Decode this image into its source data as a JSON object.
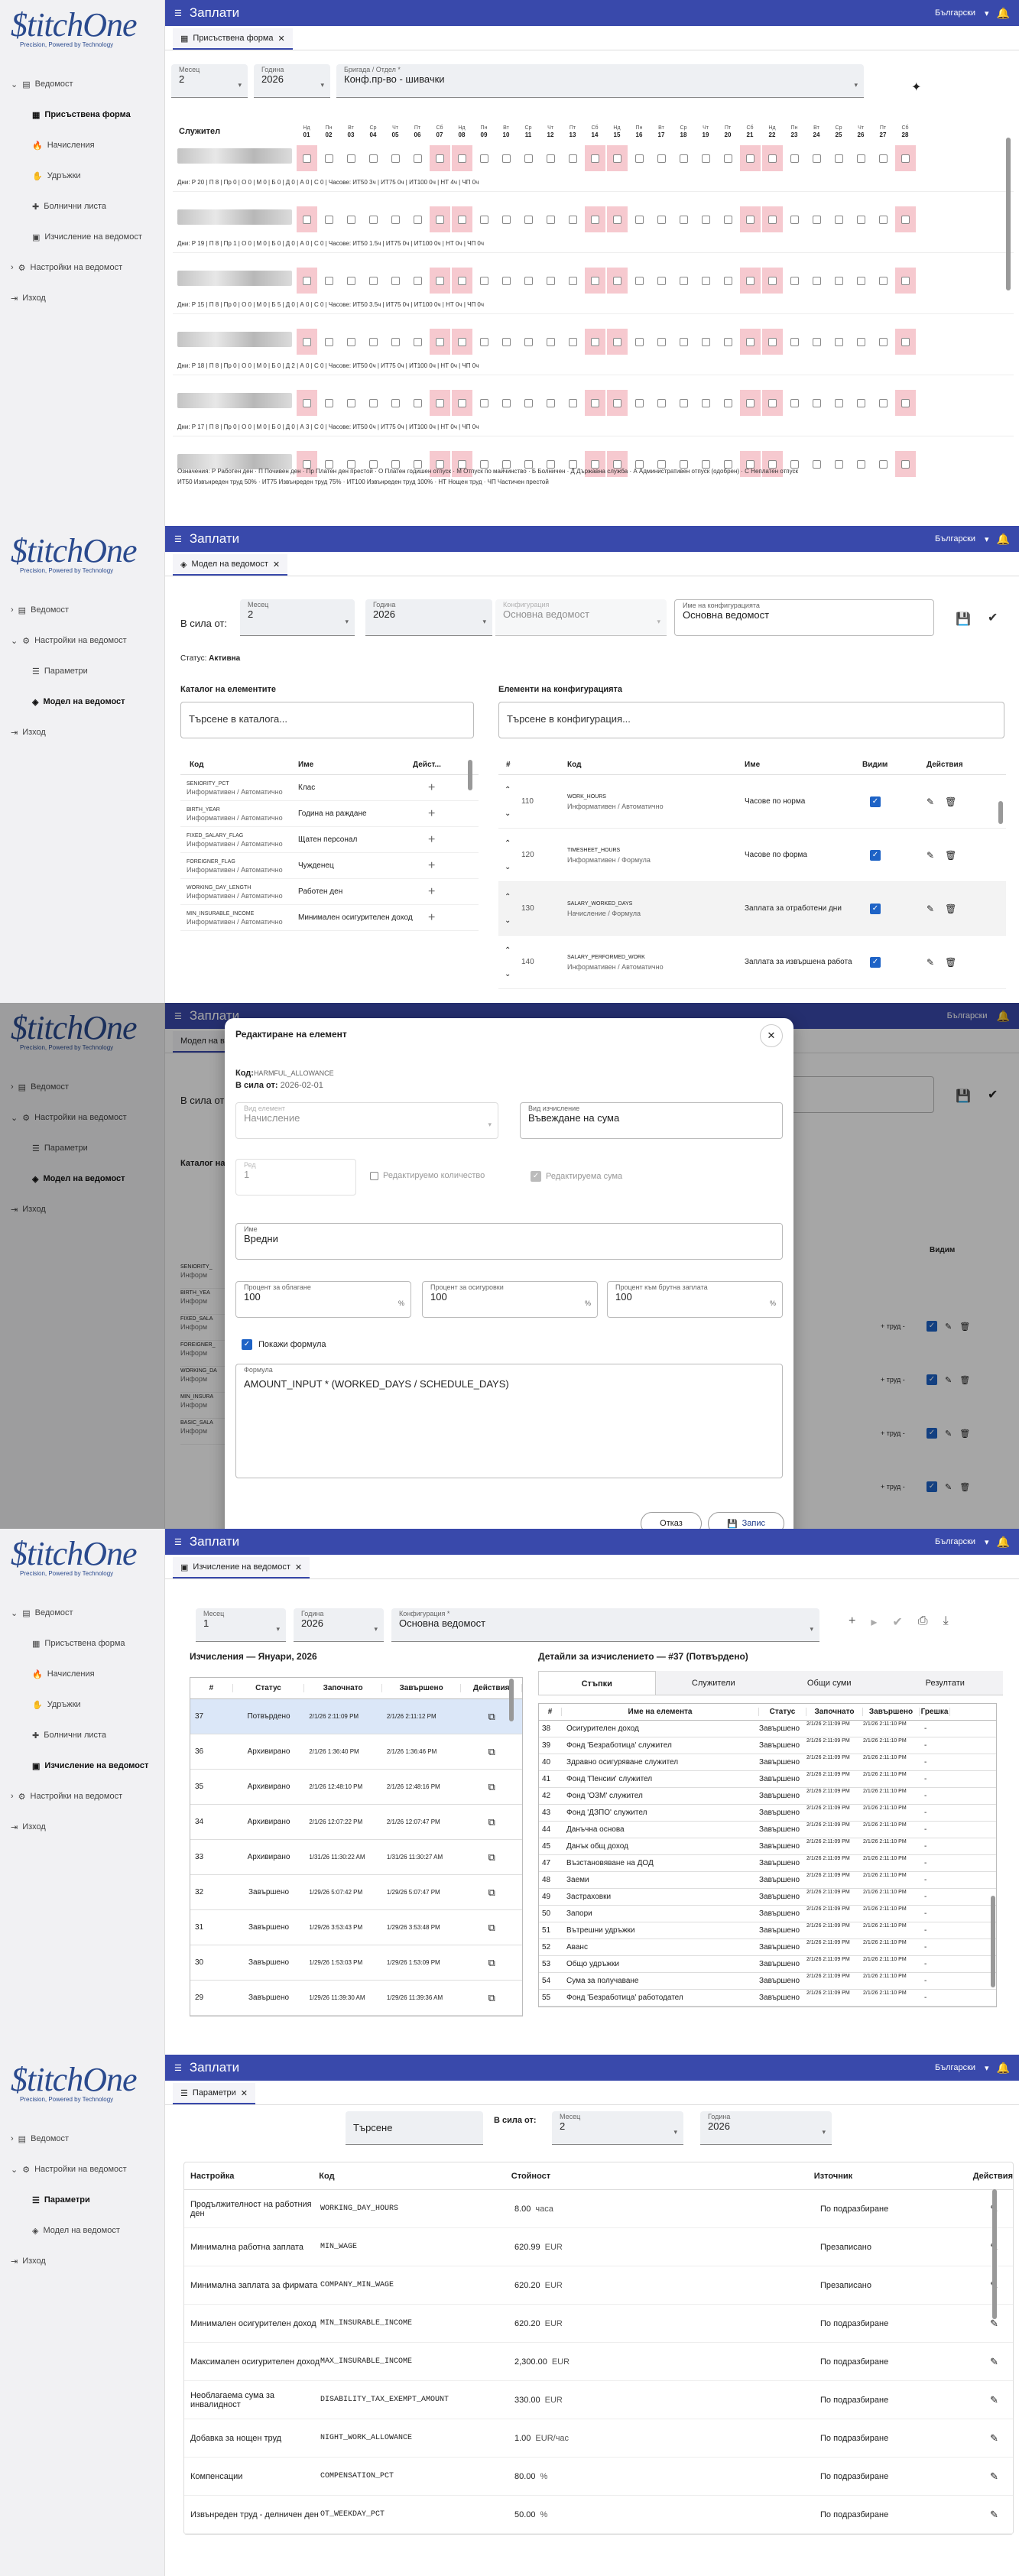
{
  "app": {
    "logo_text": "$titchOne",
    "logo_tagline": "Precision, Powered by Technology",
    "title": "Заплати",
    "language": "Български",
    "nav": {
      "payroll": "Ведомост",
      "attendance": "Присъствена форма",
      "accruals": "Начисления",
      "deductions": "Удръжки",
      "sick": "Болнични листа",
      "calc": "Изчисление на ведомост",
      "settings": "Настройки на ведомост",
      "params": "Параметри",
      "model": "Модел на ведомост",
      "logout": "Изход"
    }
  },
  "s1": {
    "tab": "Присъствена форма",
    "month_label": "Месец",
    "month": "2",
    "year_label": "Година",
    "year": "2026",
    "brigade_label": "Бригада / Отдел *",
    "brigade": "Конф.пр-во - шивачки",
    "employee_col": "Служител",
    "day_names": [
      "Нд",
      "Пн",
      "Вт",
      "Ср",
      "Чт",
      "Пт",
      "Сб",
      "Нд",
      "Пн",
      "Вт",
      "Ср",
      "Чт",
      "Пт",
      "Сб",
      "Нд",
      "Пн",
      "Вт",
      "Ср",
      "Чт",
      "Пт",
      "Сб",
      "Нд",
      "Пн",
      "Вт",
      "Ср",
      "Чт",
      "Пт",
      "Сб"
    ],
    "days": [
      "01",
      "02",
      "03",
      "04",
      "05",
      "06",
      "07",
      "08",
      "09",
      "10",
      "11",
      "12",
      "13",
      "14",
      "15",
      "16",
      "17",
      "18",
      "19",
      "20",
      "21",
      "22",
      "23",
      "24",
      "25",
      "26",
      "27",
      "28"
    ],
    "summaries": [
      "Дни: Р 20 | П 8 | Пр 0 | О 0 | М 0 | Б 0 | Д 0 | А 0 | С 0 | Часове: ИТ50 3ч | ИТ75 0ч | ИТ100 0ч | НТ 4ч | ЧП 0ч",
      "Дни: Р 19 | П 8 | Пр 1 | О 0 | М 0 | Б 0 | Д 0 | А 0 | С 0 | Часове: ИТ50 1.5ч | ИТ75 0ч | ИТ100 0ч | НТ 0ч | ЧП 0ч",
      "Дни: Р 15 | П 8 | Пр 0 | О 0 | М 0 | Б 5 | Д 0 | А 0 | С 0 | Часове: ИТ50 3.5ч | ИТ75 0ч | ИТ100 0ч | НТ 0ч | ЧП 0ч",
      "Дни: Р 18 | П 8 | Пр 0 | О 0 | М 0 | Б 0 | Д 2 | А 0 | С 0 | Часове: ИТ50 0ч | ИТ75 0ч | ИТ100 0ч | НТ 0ч | ЧП 0ч",
      "Дни: Р 17 | П 8 | Пр 0 | О 0 | М 0 | Б 0 | Д 0 | А 3 | С 0 | Часове: ИТ50 0ч | ИТ75 0ч | ИТ100 0ч | НТ 0ч | ЧП 0ч"
    ],
    "legend1": "Означения: Р Работен ден · П Почивен ден · Пр Платен ден престой · О Платен годишен отпуск · М Отпуск по майчинство · Б Болничен · Д Държавна служба · А Административен отпуск (одобрен) · С Неплатен отпуск",
    "legend2": "ИТ50 Извънреден труд 50% · ИТ75 Извънреден труд 75% · ИТ100 Извънреден труд 100% · НТ Нощен труд · ЧП Частичен престой"
  },
  "s2": {
    "tab": "Модел на ведомост",
    "effective_label": "В сила от:",
    "month_label": "Месец",
    "month": "2",
    "year_label": "Година",
    "year": "2026",
    "config_label": "Конфигурация",
    "config": "Основна ведомост",
    "config_name_label": "Име на конфигурацията",
    "config_name": "Основна ведомост",
    "status_label": "Статус:",
    "status": "Активна",
    "catalog_title": "Каталог на елементите",
    "catalog_search": "Търсене в каталога...",
    "catalog_cols": {
      "code": "Код",
      "name": "Име",
      "actions": "Дейст..."
    },
    "catalog": [
      {
        "code": "SENIORITY_PCT",
        "type": "Информативен / Автоматично",
        "name": "Клас"
      },
      {
        "code": "BIRTH_YEAR",
        "type": "Информативен / Автоматично",
        "name": "Година на раждане"
      },
      {
        "code": "FIXED_SALARY_FLAG",
        "type": "Информативен / Автоматично",
        "name": "Щатен персонал"
      },
      {
        "code": "FOREIGNER_FLAG",
        "type": "Информативен / Автоматично",
        "name": "Чужденец"
      },
      {
        "code": "WORKING_DAY_LENGTH",
        "type": "Информативен / Автоматично",
        "name": "Работен ден"
      },
      {
        "code": "MIN_INSURABLE_INCOME",
        "type": "Информативен / Автоматично",
        "name": "Минимален осигурителен доход"
      }
    ],
    "config_title": "Елементи на конфигурацията",
    "config_search": "Търсене в конфигурация...",
    "config_cols": {
      "no": "#",
      "code": "Код",
      "name": "Име",
      "visible": "Видим",
      "actions": "Действия"
    },
    "config_items": [
      {
        "no": "110",
        "code": "WORK_HOURS",
        "type": "Информативен / Автоматично",
        "name": "Часове по норма"
      },
      {
        "no": "120",
        "code": "TIMESHEET_HOURS",
        "type": "Информативен / Формула",
        "name": "Часове по форма"
      },
      {
        "no": "130",
        "code": "SALARY_WORKED_DAYS",
        "type": "Начисление / Формула",
        "name": "Заплата за отработени дни"
      },
      {
        "no": "140",
        "code": "SALARY_PERFORMED_WORK",
        "type": "Информативен / Автоматично",
        "name": "Заплата за извършена работа"
      }
    ]
  },
  "s3": {
    "dialog_title": "Редактиране на елемент",
    "code_label": "Код:",
    "code": "HARMFUL_ALLOWANCE",
    "eff_label": "В сила от:",
    "eff": "2026-02-01",
    "element_type_label": "Вид елемент",
    "element_type": "Начисление",
    "calc_type_label": "Вид изчисление",
    "calc_type": "Въвеждане на сума",
    "order_label": "Ред",
    "order": "1",
    "edit_qty": "Редактируемо количество",
    "edit_sum": "Редактируема сума",
    "name_label": "Име",
    "name": "Вредни",
    "tax_label": "Процент за облагане",
    "tax": "100",
    "ins_label": "Процент за осигуровки",
    "ins": "100",
    "gross_label": "Процент към брутна заплата",
    "gross": "100",
    "pct": "%",
    "show_formula": "Покажи формула",
    "formula_label": "Формула",
    "formula": "AMOUNT_INPUT * (WORKED_DAYS / SCHEDULE_DAYS)",
    "cancel": "Отказ",
    "save": "Запис",
    "bg_codes": [
      "SENIORITY_",
      "BIRTH_YEA",
      "FIXED_SALA",
      "FOREIGNER_",
      "WORKING_DA",
      "MIN_INSURA",
      "BASIC_SALA"
    ],
    "bg_text": "Информ",
    "bg_right": "+ труд -",
    "bg_visible_label": "Видим"
  },
  "s4": {
    "tab": "Изчисление на ведомост",
    "month_label": "Месец",
    "month": "1",
    "year_label": "Година",
    "year": "2026",
    "config_label": "Конфигурация *",
    "config": "Основна ведомост",
    "list_title": "Изчисления — Януари, 2026",
    "list_cols": [
      "#",
      "Статус",
      "Започнато",
      "Завършено",
      "Действия"
    ],
    "runs": [
      {
        "no": "37",
        "status": "Потвърдено",
        "start": "2/1/26 2:11:09 PM",
        "end": "2/1/26 2:11:12 PM"
      },
      {
        "no": "36",
        "status": "Архивирано",
        "start": "2/1/26 1:36:40 PM",
        "end": "2/1/26 1:36:46 PM"
      },
      {
        "no": "35",
        "status": "Архивирано",
        "start": "2/1/26 12:48:10 PM",
        "end": "2/1/26 12:48:16 PM"
      },
      {
        "no": "34",
        "status": "Архивирано",
        "start": "2/1/26 12:07:22 PM",
        "end": "2/1/26 12:07:47 PM"
      },
      {
        "no": "33",
        "status": "Архивирано",
        "start": "1/31/26 11:30:22 AM",
        "end": "1/31/26 11:30:27 AM"
      },
      {
        "no": "32",
        "status": "Завършено",
        "start": "1/29/26 5:07:42 PM",
        "end": "1/29/26 5:07:47 PM"
      },
      {
        "no": "31",
        "status": "Завършено",
        "start": "1/29/26 3:53:43 PM",
        "end": "1/29/26 3:53:48 PM"
      },
      {
        "no": "30",
        "status": "Завършено",
        "start": "1/29/26 1:53:03 PM",
        "end": "1/29/26 1:53:09 PM"
      },
      {
        "no": "29",
        "status": "Завършено",
        "start": "1/29/26 11:39:30 AM",
        "end": "1/29/26 11:39:36 AM"
      }
    ],
    "detail_title": "Детайли за изчислението — #37 (Потвърдено)",
    "detail_tabs": [
      "Стъпки",
      "Служители",
      "Общи суми",
      "Резултати"
    ],
    "detail_cols": [
      "#",
      "Име на елемента",
      "Статус",
      "Започнато",
      "Завършено",
      "Грешка"
    ],
    "steps": [
      {
        "no": "38",
        "name": "Осигурителен доход"
      },
      {
        "no": "39",
        "name": "Фонд 'Безработица' служител"
      },
      {
        "no": "40",
        "name": "Здравно осигуряване служител"
      },
      {
        "no": "41",
        "name": "Фонд 'Пенсии' служител"
      },
      {
        "no": "42",
        "name": "Фонд 'ОЗМ' служител"
      },
      {
        "no": "43",
        "name": "Фонд 'ДЗПО' служител"
      },
      {
        "no": "44",
        "name": "Данъчна основа"
      },
      {
        "no": "45",
        "name": "Данък общ доход"
      },
      {
        "no": "47",
        "name": "Възстановяване на ДОД"
      },
      {
        "no": "48",
        "name": "Заеми"
      },
      {
        "no": "49",
        "name": "Застраховки"
      },
      {
        "no": "50",
        "name": "Запори"
      },
      {
        "no": "51",
        "name": "Вътрешни удръжки"
      },
      {
        "no": "52",
        "name": "Аванс"
      },
      {
        "no": "53",
        "name": "Общо удръжки"
      },
      {
        "no": "54",
        "name": "Сума за получаване"
      },
      {
        "no": "55",
        "name": "Фонд 'Безработица' работодател"
      }
    ],
    "step_status": "Завършено",
    "step_start": "2/1/26 2:11:09 PM",
    "step_end": "2/1/26 2:11:10 PM",
    "step_err": "-"
  },
  "s5": {
    "tab": "Параметри",
    "search": "Търсене",
    "effective_label": "В сила от:",
    "month_label": "Месец",
    "month": "2",
    "year_label": "Година",
    "year": "2026",
    "cols": {
      "setting": "Настройка",
      "code": "Код",
      "value": "Стойност",
      "source": "Източник",
      "actions": "Действия"
    },
    "rows": [
      {
        "setting": "Продължителност на работния ден",
        "code": "WORKING_DAY_HOURS",
        "value": "8.00",
        "unit": "часа",
        "source": "По подразбиране"
      },
      {
        "setting": "Минимална работна заплата",
        "code": "MIN_WAGE",
        "value": "620.99",
        "unit": "EUR",
        "source": "Презаписано"
      },
      {
        "setting": "Минимална заплата за фирмата",
        "code": "COMPANY_MIN_WAGE",
        "value": "620.20",
        "unit": "EUR",
        "source": "Презаписано"
      },
      {
        "setting": "Минимален осигурителен доход",
        "code": "MIN_INSURABLE_INCOME",
        "value": "620.20",
        "unit": "EUR",
        "source": "По подразбиране"
      },
      {
        "setting": "Максимален осигурителен доход",
        "code": "MAX_INSURABLE_INCOME",
        "value": "2,300.00",
        "unit": "EUR",
        "source": "По подразбиране"
      },
      {
        "setting": "Необлагаема сума за инвалидност",
        "code": "DISABILITY_TAX_EXEMPT_AMOUNT",
        "value": "330.00",
        "unit": "EUR",
        "source": "По подразбиране"
      },
      {
        "setting": "Добавка за нощен труд",
        "code": "NIGHT_WORK_ALLOWANCE",
        "value": "1.00",
        "unit": "EUR/час",
        "source": "По подразбиране"
      },
      {
        "setting": "Компенсации",
        "code": "COMPENSATION_PCT",
        "value": "80.00",
        "unit": "%",
        "source": "По подразбиране"
      },
      {
        "setting": "Извънреден труд - делничен ден",
        "code": "OT_WEEKDAY_PCT",
        "value": "50.00",
        "unit": "%",
        "source": "По подразбиране"
      }
    ]
  },
  "colors": {
    "primary": "#3949ab",
    "weekend": "#f6c9cf",
    "check": "#1e63c6",
    "bell": "#f6b830"
  }
}
